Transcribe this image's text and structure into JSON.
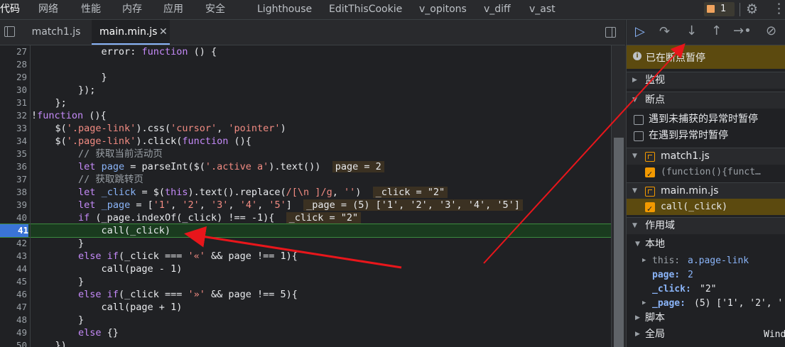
{
  "top_tabs": [
    "代码",
    "网络",
    "性能",
    "内存",
    "应用",
    "安全",
    "Lighthouse",
    "EditThisCookie",
    "v_opitons",
    "v_diff",
    "v_ast"
  ],
  "issues_count": "1",
  "file_tabs": [
    "match1.js",
    "main.min.js"
  ],
  "code_lines": [
    {
      "num": "27",
      "text": "            error: function () {"
    },
    {
      "num": "28",
      "text": ""
    },
    {
      "num": "29",
      "text": "            }"
    },
    {
      "num": "30",
      "text": "        });"
    },
    {
      "num": "31",
      "text": "    };"
    },
    {
      "num": "32",
      "text": "!function (){"
    },
    {
      "num": "33",
      "text": "    $('.page-link').css('cursor', 'pointer')"
    },
    {
      "num": "34",
      "text": "    $('.page-link').click(function (){"
    },
    {
      "num": "35",
      "text": "        // 获取当前活动页"
    },
    {
      "num": "36",
      "text": "        let page = parseInt($('.active a').text())"
    },
    {
      "num": "37",
      "text": "        // 获取跳转页"
    },
    {
      "num": "38",
      "text": "        let _click = $(this).text().replace(/[\\n ]/g, '')"
    },
    {
      "num": "39",
      "text": "        let _page = ['1', '2', '3', '4', '5']"
    },
    {
      "num": "40",
      "text": "        if (_page.indexOf(_click) !== -1){"
    },
    {
      "num": "41",
      "text": "            call(_click)"
    },
    {
      "num": "42",
      "text": "        }"
    },
    {
      "num": "43",
      "text": "        else if(_click === '«' && page !== 1){"
    },
    {
      "num": "44",
      "text": "            call(page - 1)"
    },
    {
      "num": "45",
      "text": "        }"
    },
    {
      "num": "46",
      "text": "        else if(_click === '»' && page !== 5){"
    },
    {
      "num": "47",
      "text": "            call(page + 1)"
    },
    {
      "num": "48",
      "text": "        }"
    },
    {
      "num": "49",
      "text": "        else {}"
    },
    {
      "num": "50",
      "text": "    })"
    }
  ],
  "inline_values": {
    "line36": "page = 2",
    "line38": "_click = \"2\"",
    "line39": "_page = (5) ['1', '2', '3', '4', '5']",
    "line40": "_click = \"2\""
  },
  "right_panel": {
    "paused": "已在断点暂停",
    "watch": "监视",
    "breakpoints": "断点",
    "pause_uncaught": "遇到未捕获的异常时暂停",
    "pause_caught": "在遇到异常时暂停",
    "bp_file1": "match1.js",
    "bp_file1_code": "(function(){funct…",
    "bp_file2": "main.min.js",
    "bp_file2_code": "call(_click)",
    "scope": "作用域",
    "local": "本地",
    "this_key": "this:",
    "this_val": "a.page-link",
    "page_key": "page:",
    "page_val": "2",
    "click_key": "_click:",
    "click_val": "\"2\"",
    "pagearr_key": "_page:",
    "pagearr_val": "(5) ['1', '2', '",
    "script": "脚本",
    "global": "全局",
    "global_val": "Wind"
  },
  "colors": {
    "breakpoint_line": "#1a3b1f",
    "accent": "#8ab4f8",
    "arrow": "#e8161b",
    "paused_bg": "#5c4a0f"
  }
}
